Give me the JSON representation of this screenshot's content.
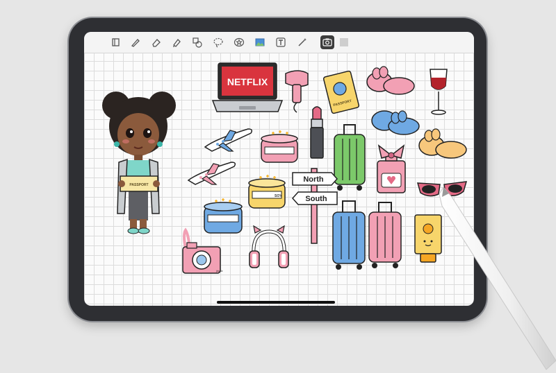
{
  "toolbar": {
    "tools": [
      {
        "icon": "layers-icon"
      },
      {
        "icon": "pencil-icon"
      },
      {
        "icon": "eraser-icon"
      },
      {
        "icon": "highlighter-icon"
      },
      {
        "icon": "shapes-icon"
      },
      {
        "icon": "lasso-icon"
      },
      {
        "icon": "sticker-icon"
      },
      {
        "icon": "image-icon"
      },
      {
        "icon": "text-icon"
      },
      {
        "icon": "magic-wand-icon"
      },
      {
        "icon": "camera-icon",
        "active": true
      },
      {
        "icon": "template-icon"
      }
    ]
  },
  "stickers": {
    "laptop_label": "NETFLIX",
    "passport_label": "PASSPORT",
    "ticket_label": "PASSPORT",
    "sign_north": "North",
    "sign_south": "South",
    "candle_label": "SOY",
    "camera_signature": "jdudz"
  },
  "colors": {
    "pink": "#f2a0b4",
    "blue": "#6fa9e3",
    "green": "#7cc96a",
    "yellow": "#f7d56b",
    "red": "#d9343e",
    "tablet_frame": "#2e2f33"
  }
}
